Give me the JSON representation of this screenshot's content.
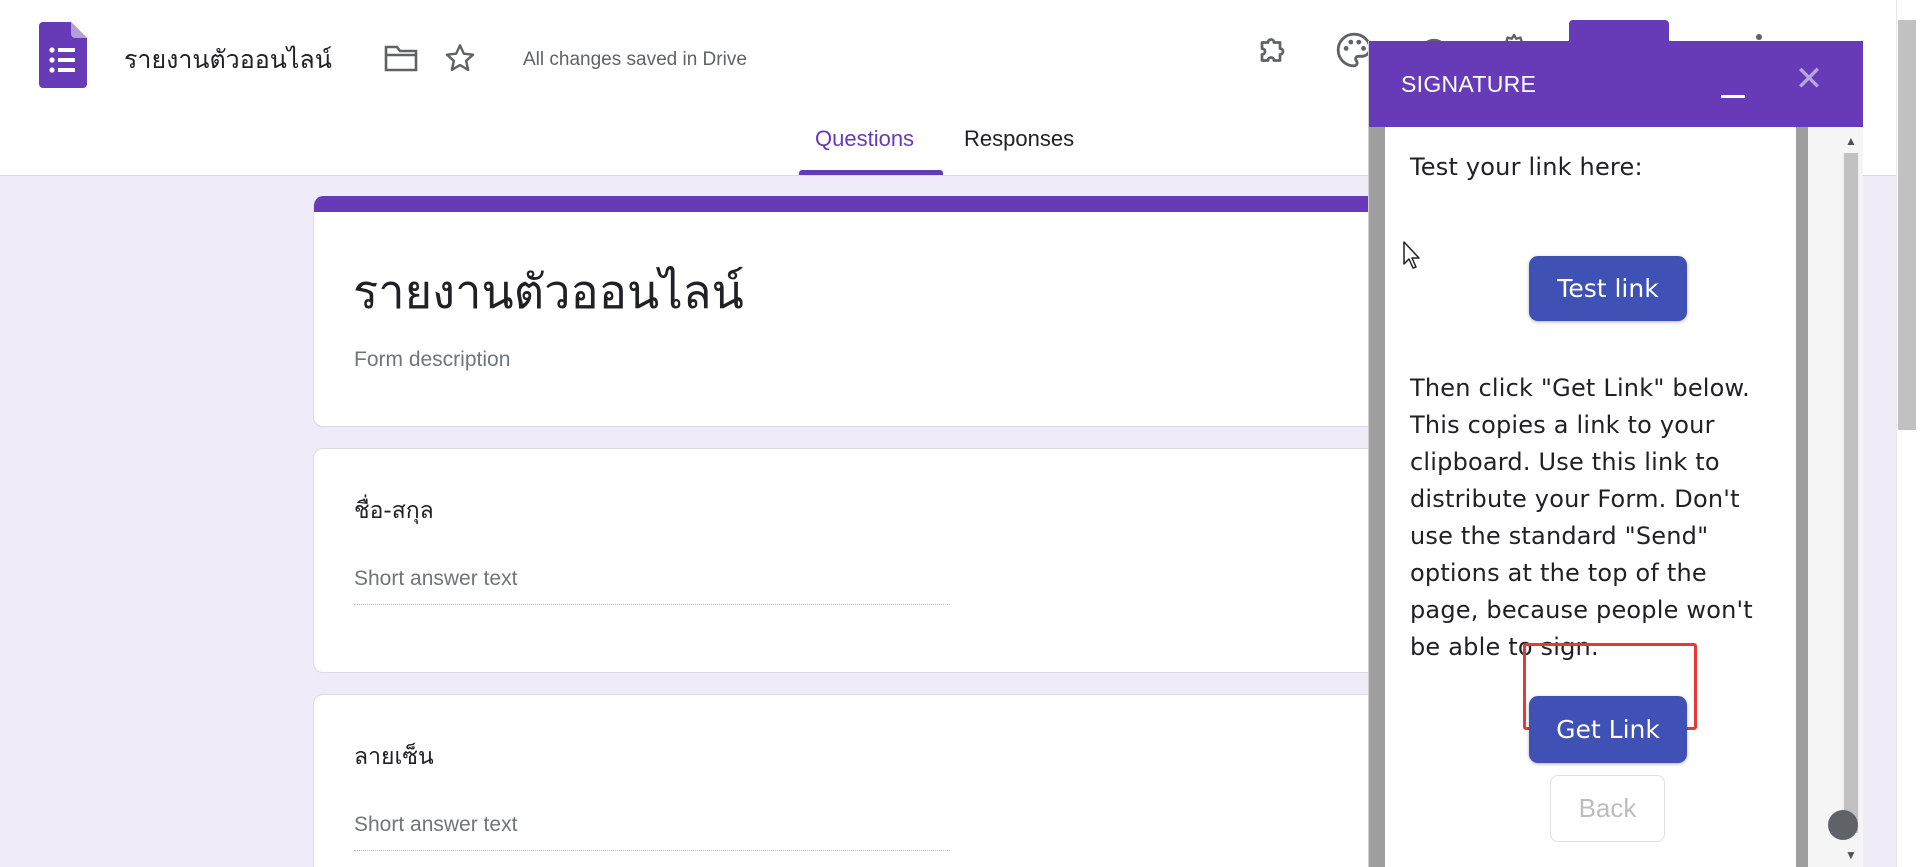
{
  "header": {
    "doc_title": "รายงานตัวออนไลน์",
    "saved_status": "All changes saved in Drive",
    "icons": [
      "forms-app-icon",
      "folder-icon",
      "star-icon",
      "addons-puzzle-icon",
      "palette-icon",
      "preview-eye-icon",
      "settings-gear-icon",
      "more-vert-icon"
    ],
    "brand_color": "#673ab7"
  },
  "tabs": [
    {
      "label": "Questions",
      "active": true
    },
    {
      "label": "Responses",
      "active": false
    }
  ],
  "form": {
    "title": "รายงานตัวออนไลน์",
    "description_placeholder": "Form description",
    "questions": [
      {
        "title": "ชื่อ-สกุล",
        "answer_placeholder": "Short answer text"
      },
      {
        "title": "ลายเซ็น",
        "answer_placeholder": "Short answer text"
      }
    ]
  },
  "signature_panel": {
    "title": "SIGNATURE",
    "test_prompt": "Test your link here:",
    "test_button": "Test link",
    "instructions": [
      "Then click \"Get Link\" below.",
      "This copies a link to your",
      "clipboard. Use this link to",
      "distribute your Form. Don't",
      "use the standard \"Send\"",
      "options at the top of the",
      "page, because people won't",
      "be able to sign."
    ],
    "get_link_button": "Get Link",
    "back_button": "Back",
    "button_color": "#3f51b5",
    "highlight_color": "#e53935"
  }
}
